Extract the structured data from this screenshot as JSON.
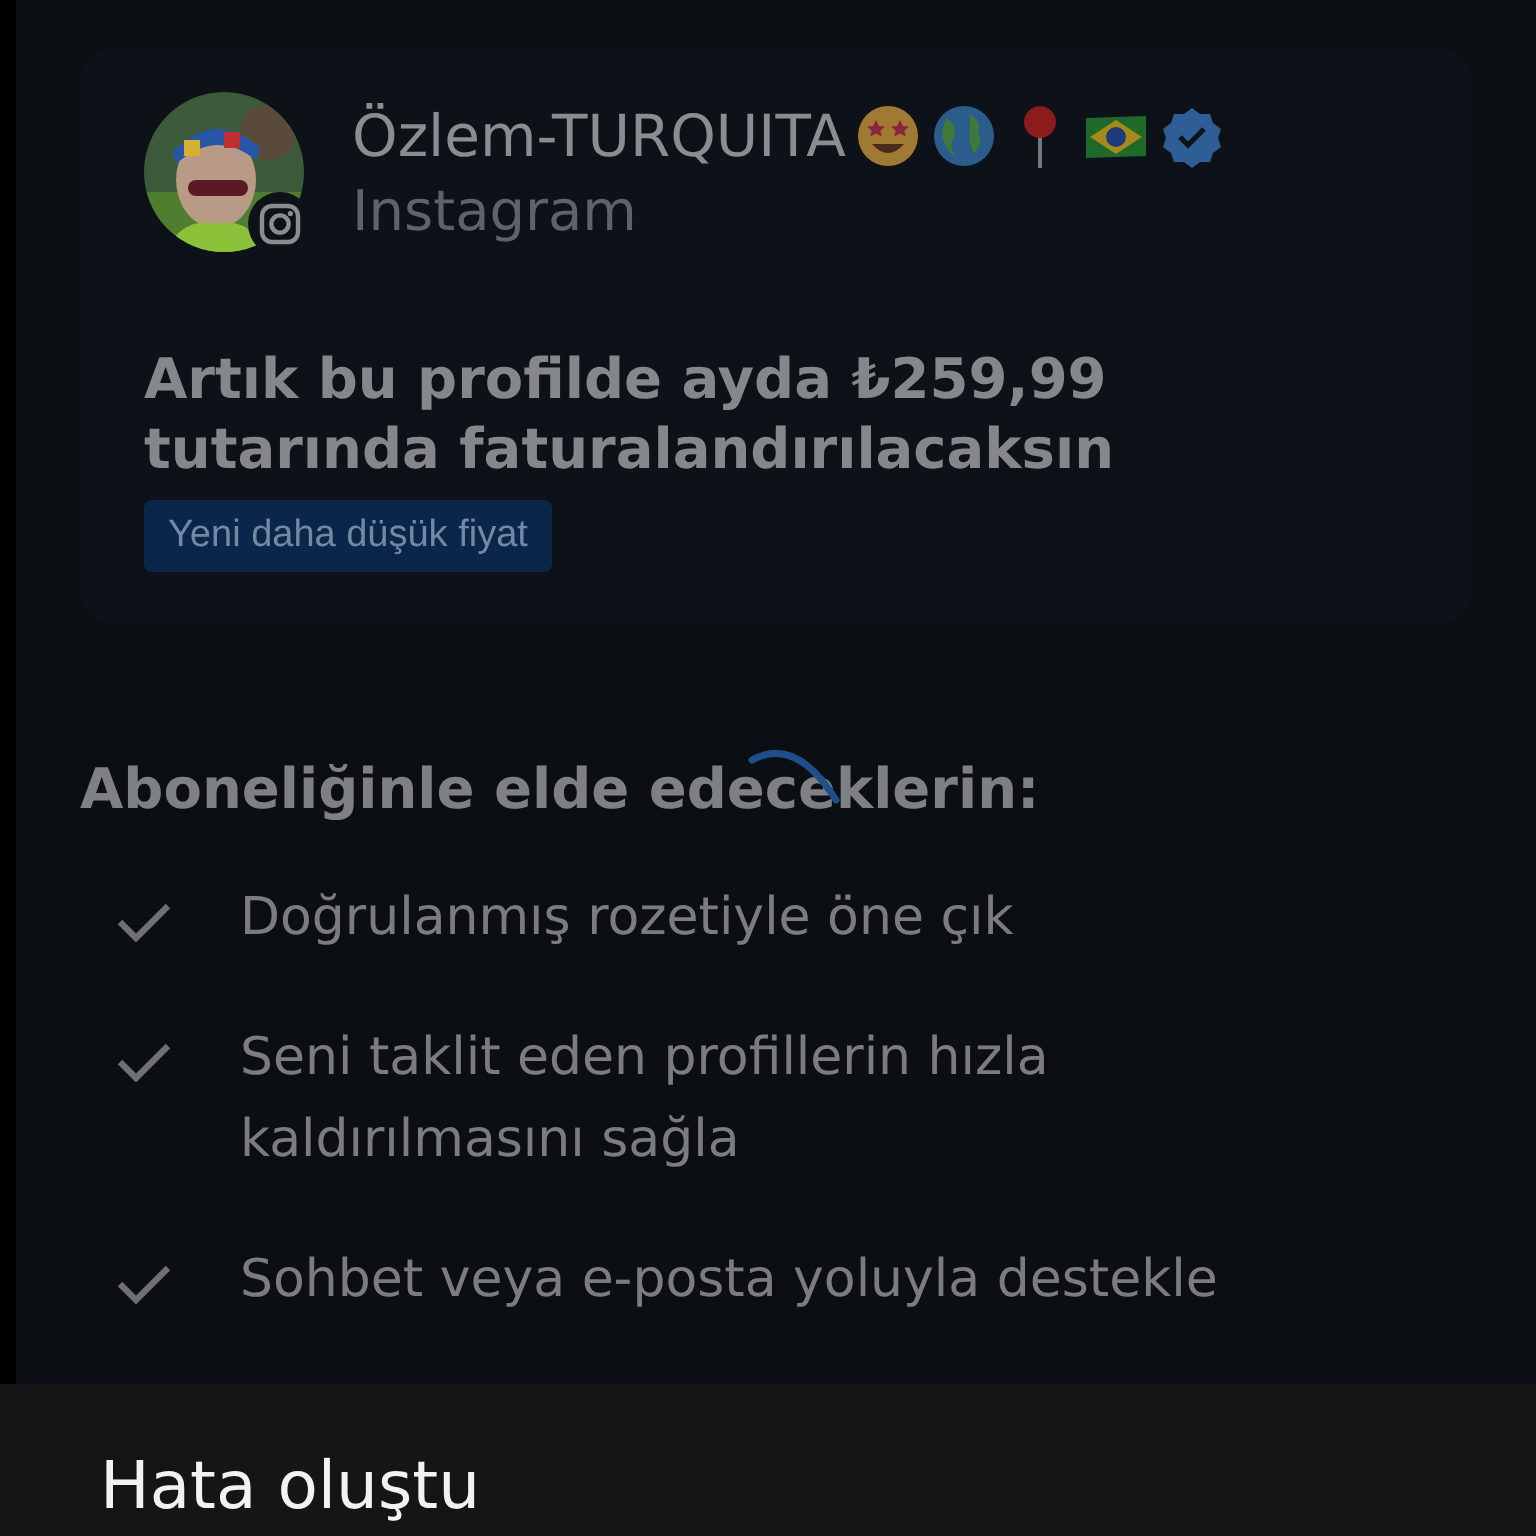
{
  "profile": {
    "name": "Özlem-TURQUITA",
    "platform": "Instagram",
    "verified": true
  },
  "price_text": "Artık bu profilde ayda ₺259,99 tutarında faturalandırılacaksın",
  "price_badge": "Yeni daha düşük fiyat",
  "benefits_title": "Aboneliğinle elde edeceklerin:",
  "loading": true,
  "benefits": [
    {
      "text": "Doğrulanmış rozetiyle öne çık"
    },
    {
      "text": "Seni taklit eden profillerin hızla kaldırılmasını sağla"
    },
    {
      "text": "Sohbet veya e-posta yoluyla destekle"
    }
  ],
  "error_sheet": {
    "title": "Hata oluştu"
  }
}
